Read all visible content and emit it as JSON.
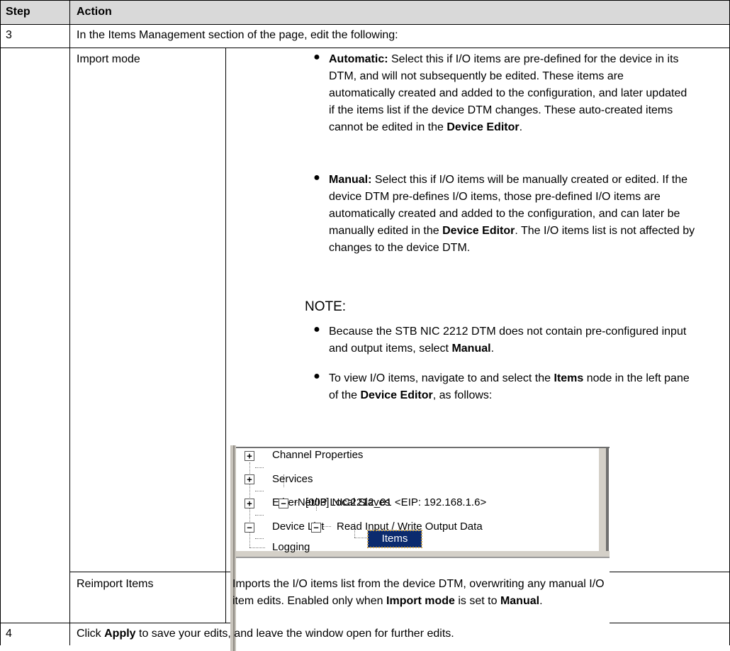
{
  "header": {
    "step": "Step",
    "action": "Action"
  },
  "row3": {
    "step": "3",
    "intro": "In the Items Management section of the page, edit the following:",
    "import_mode": {
      "label": "Import mode",
      "automatic": {
        "term": "Automatic:",
        "line1": " Select this if I/O items are pre-defined for the device in its",
        "line2": "DTM, and will not subsequently be edited. These items are",
        "line3": "automatically created and added to the configuration, and later updated",
        "line4": "if the items list if the device DTM changes. These auto-created items",
        "line5a": "cannot be edited in the ",
        "line5b": "Device Editor",
        "line5c": "."
      },
      "manual": {
        "term": "Manual:",
        "line1": " Select this if I/O items will be manually created or edited. If the",
        "line2": "device DTM pre-defines I/O items, those pre-defined I/O items are",
        "line3": "automatically created and added to the configuration, and can later be",
        "line4a": "manually edited in the ",
        "line4b": "Device Editor",
        "line4c": ". The I/O items list is not affected by",
        "line5": "changes to the device DTM."
      },
      "note": {
        "title": "NOTE:",
        "b1_line1": "Because the STB NIC 2212 DTM does not contain pre-configured input",
        "b1_line2a": "and output items, select ",
        "b1_line2b": "Manual",
        "b1_line2c": ".",
        "b2_line1a": "To view I/O items, navigate to and select the ",
        "b2_line1b": "Items",
        "b2_line1c": " node in the left pane",
        "b2_line2a": "of the ",
        "b2_line2b": "Device Editor",
        "b2_line2c": ", as follows:"
      },
      "tree": [
        {
          "label": "Channel Properties",
          "box": "+"
        },
        {
          "label": "Services",
          "box": "+"
        },
        {
          "label": "EtherNet/IP Local Slaves",
          "box": "+"
        },
        {
          "label": "Device List",
          "box": "−"
        },
        {
          "label": "[003] NIC2212_01 <EIP: 192.168.1.6>",
          "box": "−"
        },
        {
          "label": "Read Input / Write Output Data",
          "box": "−"
        },
        {
          "label": "Items",
          "box": ""
        },
        {
          "label": "Logging",
          "box": ""
        }
      ]
    },
    "reimport": {
      "label": "Reimport Items",
      "line1": "Imports the I/O items list from the device DTM, overwriting any manual I/O",
      "line2a": "item edits. Enabled only when ",
      "line2b": "Import mode",
      "line2c": " is set to ",
      "line2d": "Manual",
      "line2e": "."
    }
  },
  "row4": {
    "step": "4",
    "text_a": "Click ",
    "text_b": "Apply",
    "text_c": " to save your edits, and leave the window open for further edits."
  },
  "colors": {
    "header_bg": "#d9d9d9",
    "selected_bg": "#0b2a6e",
    "selected_text": "#ffffff"
  }
}
